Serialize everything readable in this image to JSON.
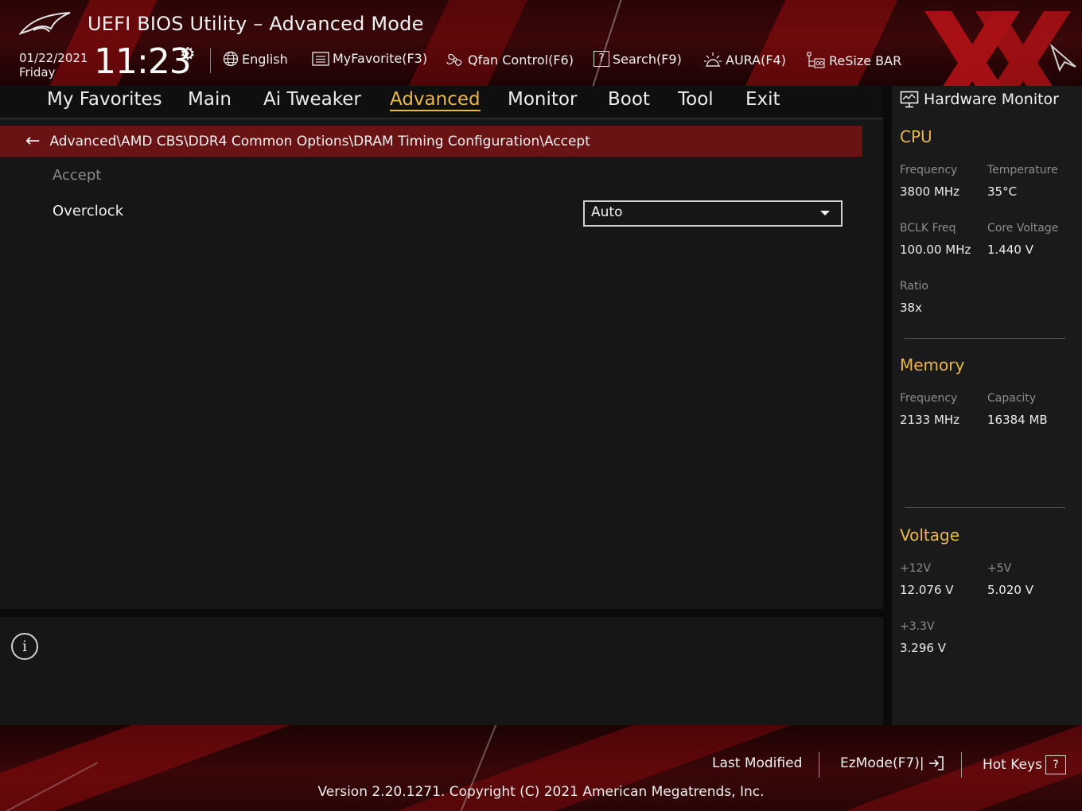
{
  "header": {
    "title": "UEFI BIOS Utility – Advanced Mode",
    "date": "01/22/2021",
    "day": "Friday",
    "time": "11:23",
    "tools": [
      {
        "label": "English",
        "icon": "globe-icon"
      },
      {
        "label": "MyFavorite(F3)",
        "icon": "favorite-list-icon"
      },
      {
        "label": "Qfan Control(F6)",
        "icon": "fan-icon"
      },
      {
        "label": "Search(F9)",
        "icon": "search-help-icon"
      },
      {
        "label": "AURA(F4)",
        "icon": "aura-light-icon"
      },
      {
        "label": "ReSize BAR",
        "icon": "resize-bar-icon"
      }
    ]
  },
  "menu": {
    "items": [
      "My Favorites",
      "Main",
      "Ai Tweaker",
      "Advanced",
      "Monitor",
      "Boot",
      "Tool",
      "Exit"
    ],
    "active": "Advanced"
  },
  "main": {
    "breadcrumb": "Advanced\\AMD CBS\\DDR4 Common Options\\DRAM Timing Configuration\\Accept",
    "rows": [
      {
        "label": "Accept",
        "disabled": true
      },
      {
        "label": "Overclock",
        "value": "Auto"
      }
    ]
  },
  "hardware_monitor": {
    "title": "Hardware Monitor",
    "cpu": {
      "heading": "CPU",
      "frequency_label": "Frequency",
      "frequency": "3800 MHz",
      "temperature_label": "Temperature",
      "temperature": "35°C",
      "bclk_label": "BCLK Freq",
      "bclk": "100.00 MHz",
      "core_voltage_label": "Core Voltage",
      "core_voltage": "1.440 V",
      "ratio_label": "Ratio",
      "ratio": "38x"
    },
    "memory": {
      "heading": "Memory",
      "frequency_label": "Frequency",
      "frequency": "2133 MHz",
      "capacity_label": "Capacity",
      "capacity": "16384 MB"
    },
    "voltage": {
      "heading": "Voltage",
      "v12_label": "+12V",
      "v12": "12.076 V",
      "v5_label": "+5V",
      "v5": "5.020 V",
      "v33_label": "+3.3V",
      "v33": "3.296 V"
    }
  },
  "footer": {
    "last_modified": "Last Modified",
    "ezmode": "EzMode(F7)|",
    "hotkeys": "Hot Keys",
    "hotkeys_key": "?",
    "version": "Version 2.20.1271. Copyright (C) 2021 American Megatrends, Inc."
  },
  "colors": {
    "accent": "#e8b84c",
    "breadcrumb_bg": "#6a1315",
    "background": "#161616"
  }
}
